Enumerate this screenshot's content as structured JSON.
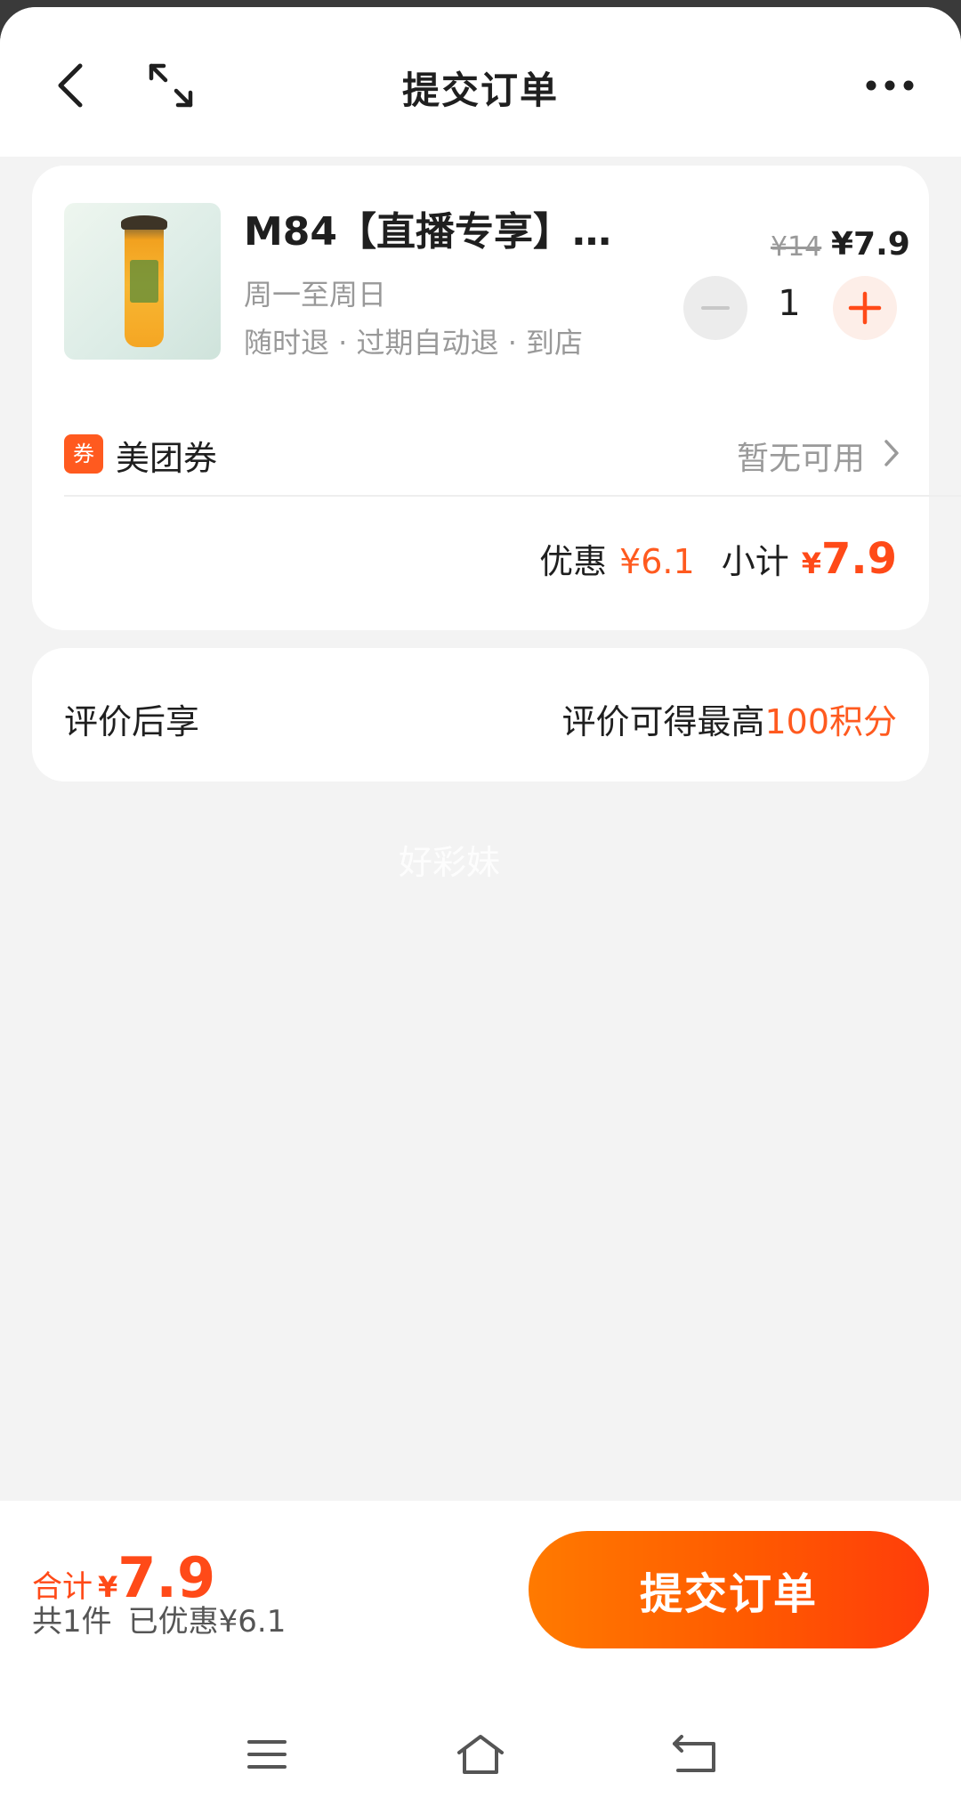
{
  "header": {
    "title": "提交订单",
    "icons": [
      "back-arrow-icon",
      "expand-icon",
      "more-icon"
    ]
  },
  "order": {
    "product_name": "M84【直播专享】…",
    "validity": "周一至周日",
    "policy": "随时退 · 过期自动退 · 到店",
    "original_price": "¥14",
    "price": "¥7.9",
    "quantity": "1",
    "coupon": {
      "tag": "券",
      "label": "美团券",
      "status": "暂无可用"
    },
    "discount_label": "优惠",
    "discount_value": "¥6.1",
    "subtotal_label": "小计",
    "subtotal_currency": "¥",
    "subtotal_value": "7.9"
  },
  "review": {
    "left_label": "评价后享",
    "right_prefix": "评价可得最高",
    "right_points": "100积分"
  },
  "watermark": "好彩妹",
  "footer": {
    "total_label": "合计",
    "total_currency": "¥",
    "total_value": "7.9",
    "count": "共1件",
    "saved": "已优惠¥6.1",
    "submit_label": "提交订单"
  },
  "colors": {
    "accent": "#ff5a1f",
    "button_gradient_start": "#ff7a00",
    "button_gradient_end": "#ff3d0a"
  }
}
